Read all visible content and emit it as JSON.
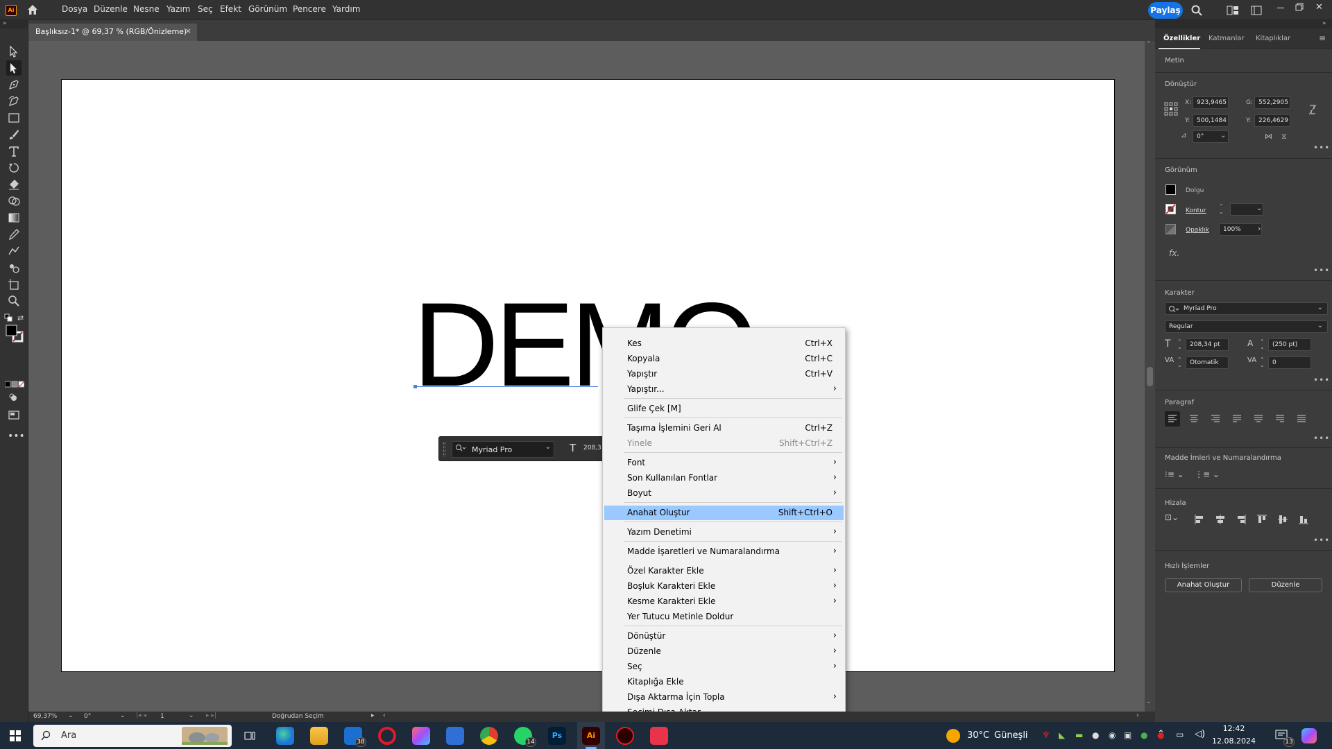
{
  "app": {
    "logo": "Ai"
  },
  "menubar": {
    "items": [
      "Dosya",
      "Düzenle",
      "Nesne",
      "Yazım",
      "Seç",
      "Efekt",
      "Görünüm",
      "Pencere",
      "Yardım"
    ],
    "share": "Paylaş"
  },
  "document": {
    "tab_title": "Başlıksız-1* @ 69,37 % (RGB/Önizleme)",
    "close_glyph": "×",
    "artboard_text": "DEMO"
  },
  "contextual_task_bar": {
    "font": "Myriad Pro",
    "size_partial": "208,3"
  },
  "context_menu": {
    "items": [
      {
        "label": "Kes",
        "shortcut": "Ctrl+X"
      },
      {
        "label": "Kopyala",
        "shortcut": "Ctrl+C"
      },
      {
        "label": "Yapıştır",
        "shortcut": "Ctrl+V"
      },
      {
        "label": "Yapıştır...",
        "submenu": true
      },
      {
        "label": "Glife Çek [M]"
      },
      {
        "label": "Taşıma İşlemini Geri Al",
        "shortcut": "Ctrl+Z"
      },
      {
        "label": "Yinele",
        "shortcut": "Shift+Ctrl+Z",
        "disabled": true
      },
      {
        "label": "Font",
        "submenu": true
      },
      {
        "label": "Son Kullanılan Fontlar",
        "submenu": true
      },
      {
        "label": "Boyut",
        "submenu": true
      },
      {
        "label": "Anahat Oluştur",
        "shortcut": "Shift+Ctrl+O",
        "highlighted": true
      },
      {
        "label": "Yazım Denetimi",
        "submenu": true
      },
      {
        "label": "Madde İşaretleri ve Numaralandırma",
        "submenu": true
      },
      {
        "label": "Özel Karakter Ekle",
        "submenu": true
      },
      {
        "label": "Boşluk Karakteri Ekle",
        "submenu": true
      },
      {
        "label": "Kesme Karakteri Ekle",
        "submenu": true
      },
      {
        "label": "Yer Tutucu Metinle Doldur"
      },
      {
        "label": "Dönüştür",
        "submenu": true
      },
      {
        "label": "Düzenle",
        "submenu": true
      },
      {
        "label": "Seç",
        "submenu": true
      },
      {
        "label": "Kitaplığa Ekle"
      },
      {
        "label": "Dışa Aktarma İçin Topla",
        "submenu": true
      },
      {
        "label": "Seçimi Dışa Aktar..."
      }
    ],
    "arrow_glyph": "›"
  },
  "properties_panel": {
    "tabs": [
      "Özellikler",
      "Katmanlar",
      "Kitaplıklar"
    ],
    "object_type": "Metin",
    "transform": {
      "title": "Dönüştür",
      "x_label": "X:",
      "x": "923,9465 p",
      "y_label": "Y:",
      "y": "500,1484 p",
      "w_label": "G:",
      "w": "552,2905 p",
      "h_label": "Y:",
      "h": "226,4629 p",
      "angle": "0°"
    },
    "appearance": {
      "title": "Görünüm",
      "fill": "Dolgu",
      "stroke": "Kontur",
      "opacity_label": "Opaklık",
      "opacity": "100%",
      "fx": "fx."
    },
    "character": {
      "title": "Karakter",
      "font": "Myriad Pro",
      "style": "Regular",
      "size": "208,34 pt",
      "leading": "(250 pt)",
      "kerning": "Otomatik",
      "tracking": "0"
    },
    "paragraph": {
      "title": "Paragraf"
    },
    "bullets": {
      "title": "Madde İmleri ve Numaralandırma"
    },
    "align": {
      "title": "Hizala"
    },
    "quick_actions": {
      "title": "Hızlı İşlemler",
      "create_outlines": "Anahat Oluştur",
      "arrange": "Düzenle"
    }
  },
  "statusbar": {
    "zoom": "69,37%",
    "rotation": "0°",
    "artboard": "1",
    "tool": "Doğrudan Seçim"
  },
  "taskbar": {
    "search": "Ara",
    "weather_temp": "30°C",
    "weather_desc": "Güneşli",
    "time": "12:42",
    "date": "12.08.2024",
    "mail_badge": "38",
    "whatsapp_badge": "14",
    "notif_badge": "13",
    "ps_label": "Ps",
    "ai_label": "Ai"
  },
  "colors": {
    "accent": "#1473e6",
    "highlight": "#99c9ff",
    "panel": "#3c3c3c",
    "chrome": "#323232"
  }
}
